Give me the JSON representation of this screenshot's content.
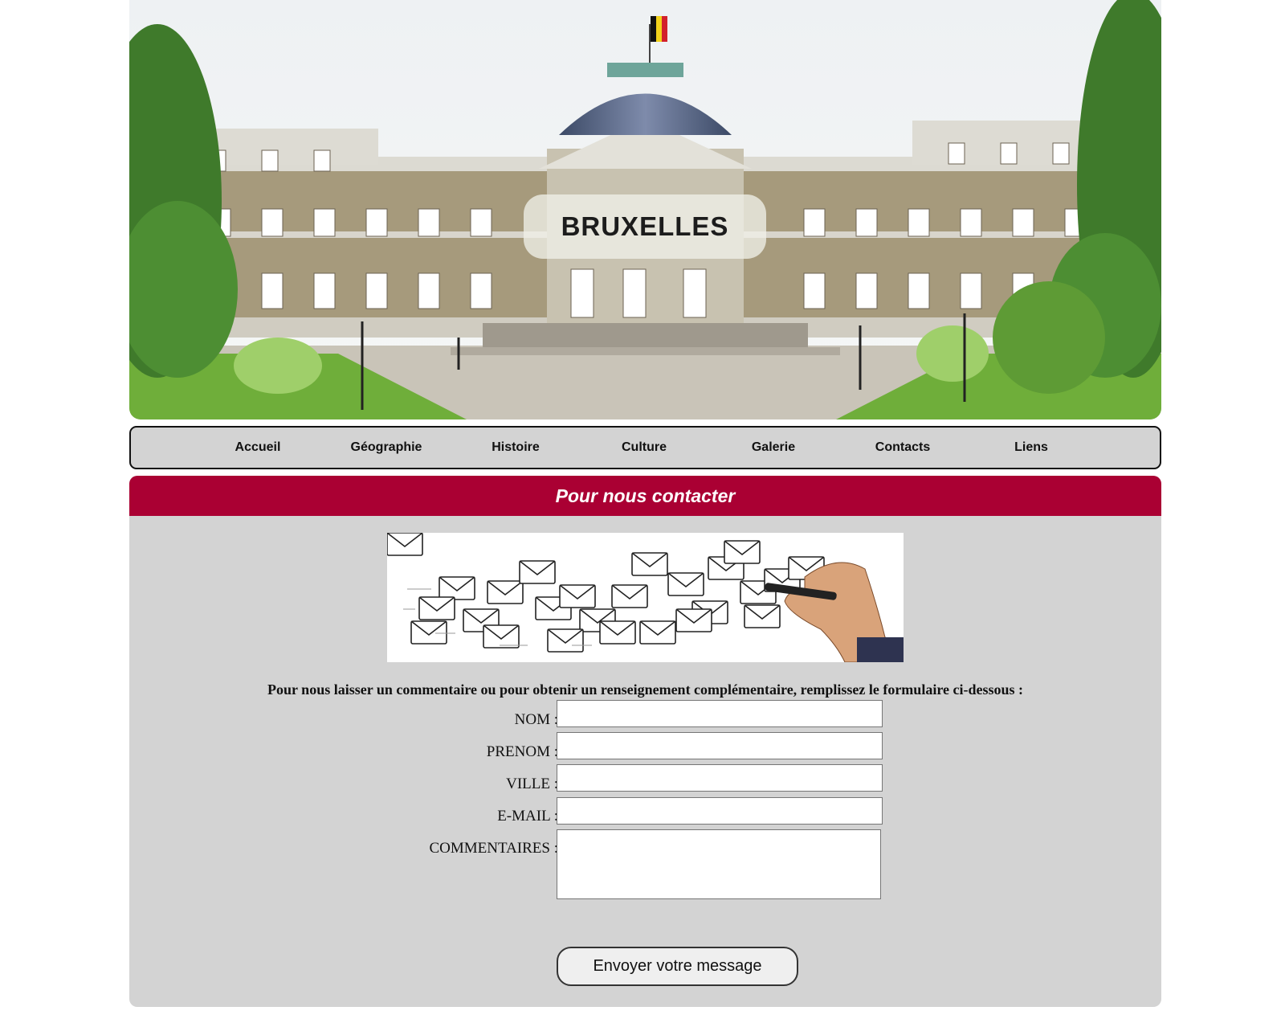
{
  "banner": {
    "title": "BRUXELLES",
    "image_alt": "Château de Laeken"
  },
  "nav": {
    "items": [
      {
        "label": "Accueil"
      },
      {
        "label": "Géographie"
      },
      {
        "label": "Histoire"
      },
      {
        "label": "Culture"
      },
      {
        "label": "Galerie"
      },
      {
        "label": "Contacts"
      },
      {
        "label": "Liens"
      }
    ]
  },
  "contact": {
    "header": "Pour nous contacter",
    "intro": "Pour nous laisser un commentaire ou pour obtenir un renseignement complémentaire, remplissez le formulaire ci-dessous :",
    "fields": {
      "nom": {
        "label": "NOM :",
        "value": ""
      },
      "prenom": {
        "label": "PRENOM :",
        "value": ""
      },
      "ville": {
        "label": "VILLE :",
        "value": ""
      },
      "email": {
        "label": "E-MAIL :",
        "value": ""
      },
      "commentaires": {
        "label": "COMMENTAIRES :",
        "value": ""
      }
    },
    "submit_label": "Envoyer votre message"
  },
  "colors": {
    "header_bar": "#aa0033",
    "panel_bg": "#d3d3d3",
    "nav_bg": "#d3d3d3"
  },
  "icons": [
    "palace-photo",
    "envelopes-illustration"
  ]
}
